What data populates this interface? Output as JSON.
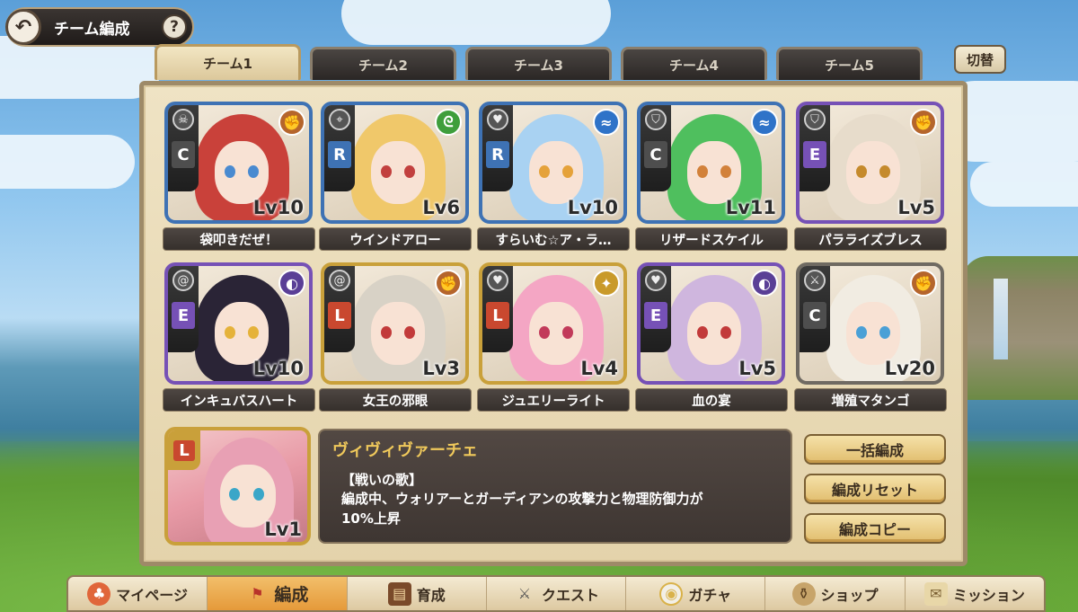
{
  "header": {
    "title": "チーム編成",
    "help_label": "?",
    "back_icon": "back-arrow-icon"
  },
  "tabs": [
    {
      "label": "チーム1",
      "active": true
    },
    {
      "label": "チーム2",
      "active": false
    },
    {
      "label": "チーム3",
      "active": false
    },
    {
      "label": "チーム4",
      "active": false
    },
    {
      "label": "チーム5",
      "active": false
    }
  ],
  "switch_label": "切替",
  "members": [
    {
      "name": "袋叩きだぜ！",
      "level": "Lv10",
      "rank": "C",
      "class_icon": "skull-icon",
      "element": "earth",
      "hair": "#c9413a",
      "eyes": "#4a8ad0",
      "frame": "#3e72b4"
    },
    {
      "name": "ウインドアロー",
      "level": "Lv6",
      "rank": "R",
      "class_icon": "crosshair-icon",
      "element": "wind",
      "hair": "#f0c86a",
      "eyes": "#c2403e",
      "frame": "#3e72b4"
    },
    {
      "name": "すらいむ☆ア・ラ…",
      "level": "Lv10",
      "rank": "R",
      "class_icon": "heart-icon",
      "element": "water",
      "hair": "#a9d2f2",
      "eyes": "#e5a23a",
      "frame": "#3e72b4"
    },
    {
      "name": "リザードスケイル",
      "level": "Lv11",
      "rank": "C",
      "class_icon": "shield-icon",
      "element": "water",
      "hair": "#4fbf5e",
      "eyes": "#d2813a",
      "frame": "#3e72b4"
    },
    {
      "name": "パラライズブレス",
      "level": "Lv5",
      "rank": "E",
      "class_icon": "shield-icon",
      "element": "earth",
      "hair": "#e7dccb",
      "eyes": "#c58a2c",
      "frame": "#7651b6"
    },
    {
      "name": "インキュバスハート",
      "level": "Lv10",
      "rank": "E",
      "class_icon": "swirl-icon",
      "element": "dark",
      "hair": "#2a2436",
      "eyes": "#e5b23a",
      "frame": "#7651b6"
    },
    {
      "name": "女王の邪眼",
      "level": "Lv3",
      "rank": "L",
      "class_icon": "swirl-icon",
      "element": "earth",
      "hair": "#d8d2c6",
      "eyes": "#c23a3a",
      "frame": "#c9a03a"
    },
    {
      "name": "ジュエリーライト",
      "level": "Lv4",
      "rank": "L",
      "class_icon": "heart-icon",
      "element": "light",
      "hair": "#f4a6c4",
      "eyes": "#c23a5a",
      "frame": "#c9a03a"
    },
    {
      "name": "血の宴",
      "level": "Lv5",
      "rank": "E",
      "class_icon": "heart-icon",
      "element": "dark",
      "hair": "#cfb6de",
      "eyes": "#c23a3a",
      "frame": "#7651b6"
    },
    {
      "name": "増殖マタンゴ",
      "level": "Lv20",
      "rank": "C",
      "class_icon": "swords-icon",
      "element": "earth",
      "hair": "#f1ece2",
      "eyes": "#4aa0d6",
      "frame": "#6f6a62"
    }
  ],
  "leader": {
    "level": "Lv1",
    "rank": "L",
    "name": "ヴィヴィヴァーチェ",
    "skill_name": "【戦いの歌】",
    "skill_desc_line1": "編成中、ウォリアーとガーディアンの攻撃力と物理防御力が",
    "skill_desc_line2": "10%上昇"
  },
  "actions": {
    "bulk_form": "一括編成",
    "reset_form": "編成リセット",
    "copy_form": "編成コピー"
  },
  "bottom_nav": [
    {
      "label": "マイページ",
      "icon": "mushroom-icon",
      "active": false
    },
    {
      "label": "編成",
      "icon": "flag-icon",
      "active": true
    },
    {
      "label": "育成",
      "icon": "book-icon",
      "active": false
    },
    {
      "label": "クエスト",
      "icon": "swords-icon",
      "active": false
    },
    {
      "label": "ガチャ",
      "icon": "egg-icon",
      "active": false
    },
    {
      "label": "ショップ",
      "icon": "potion-bag-icon",
      "active": false
    },
    {
      "label": "ミッション",
      "icon": "scroll-icon",
      "active": false
    }
  ],
  "colors": {
    "element_earth": "#b5652c",
    "element_wind": "#3f9e3c",
    "element_water": "#2f73c8",
    "element_dark": "#5a3f96",
    "element_light": "#c99a2a",
    "rank_C": "#4e4e4e",
    "rank_R": "#3e72b4",
    "rank_E": "#7651b6",
    "rank_L": "#c9482f"
  }
}
